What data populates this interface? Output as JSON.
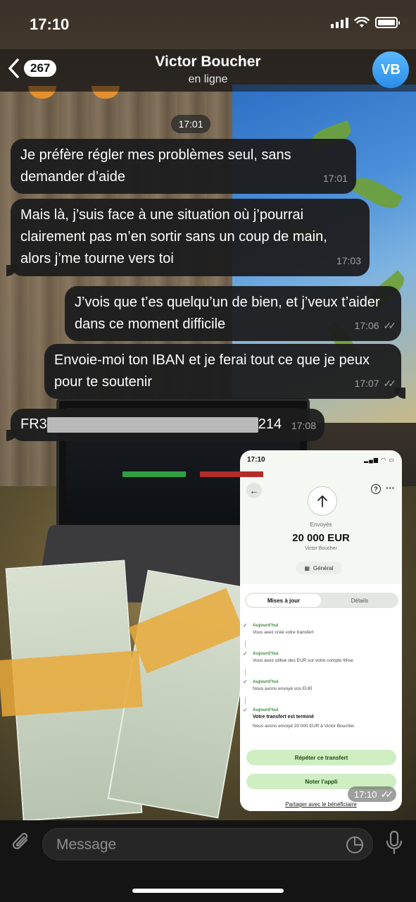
{
  "status_bar": {
    "time": "17:10"
  },
  "header": {
    "unread_count": "267",
    "contact_name": "Victor Boucher",
    "contact_status": "en ligne",
    "avatar_initials": "VB"
  },
  "chat": {
    "date_pill": "17:01",
    "messages": [
      {
        "dir": "in",
        "text": "Je préfère régler mes problèmes seul, sans demander d’aide",
        "time": "17:01"
      },
      {
        "dir": "in",
        "text": "Mais là, j’suis face à une situation où j’pourrai clairement pas m’en sortir sans un coup de main, alors j’me tourne vers toi",
        "time": "17:03"
      },
      {
        "dir": "out",
        "text": "J’vois que t’es quelqu’un de bien, et j’veux t’aider dans ce moment difficile",
        "time": "17:06"
      },
      {
        "dir": "out",
        "text": "Envoie-moi ton IBAN et je ferai tout ce que je peux pour te soutenir",
        "time": "17:07"
      },
      {
        "dir": "in",
        "text_prefix": "FR3",
        "text_suffix": "214",
        "time": "17:08"
      }
    ],
    "photo": {
      "time": "17:10",
      "screenshot": {
        "time": "17:10",
        "status_label": "Envoyés",
        "amount": "20 000 EUR",
        "recipient": "Victor Boucher",
        "category": "Général",
        "tabs": [
          "Mises à jour",
          "Détails"
        ],
        "timeline": [
          {
            "date": "Aujourd’hui",
            "text": "Vous avez créé votre transfert"
          },
          {
            "date": "Aujourd’hui",
            "text": "Vous avez utilisé des EUR sur votre compte Wise"
          },
          {
            "date": "Aujourd’hui",
            "text": "Nous avons envoyé vos EUR"
          },
          {
            "date": "Aujourd’hui",
            "text": "Votre transfert est terminé",
            "sub": "Nous avons envoyé 20 000 EUR à Victor Boucher."
          }
        ],
        "repeat_button": "Répéter ce transfert",
        "rate_button": "Noter l’appli",
        "share_link": "Partager avec le bénéficiaire"
      }
    }
  },
  "input": {
    "placeholder": "Message"
  },
  "colors": {
    "accent": "#2a8de8",
    "bubble": "#1c1c1e",
    "wise_green": "#cfeec2"
  }
}
